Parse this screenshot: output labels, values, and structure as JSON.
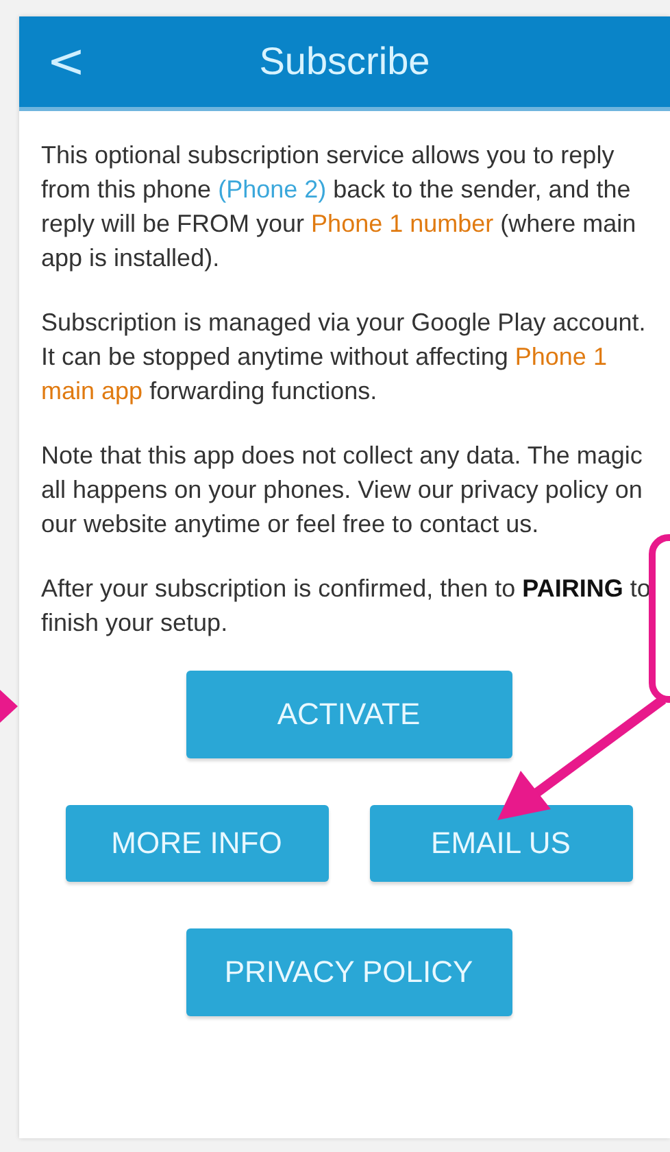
{
  "header": {
    "back": "<",
    "title": "Subscribe"
  },
  "paragraphs": [
    [
      {
        "kind": "plain",
        "text": "This optional subscription service allows you to reply from this phone "
      },
      {
        "kind": "link",
        "text": "(Phone 2)"
      },
      {
        "kind": "plain",
        "text": " back to the sender, and the reply will be FROM your "
      },
      {
        "kind": "accent",
        "text": "Phone 1 number"
      },
      {
        "kind": "plain",
        "text": " (where main app is installed)."
      }
    ],
    [
      {
        "kind": "plain",
        "text": "Subscription is managed via your Google Play account. It can be stopped anytime without affecting "
      },
      {
        "kind": "accent",
        "text": "Phone 1 main app"
      },
      {
        "kind": "plain",
        "text": " forwarding functions."
      }
    ],
    [
      {
        "kind": "plain",
        "text": "Note that this app does not collect any data. The magic all happens on your phones. View our privacy policy on our website anytime or feel free to contact us."
      }
    ],
    [
      {
        "kind": "plain",
        "text": "After your subscription is confirmed, then "
      },
      {
        "kind": "plain",
        "text": "to "
      },
      {
        "kind": "bold",
        "text": "PAIRING"
      },
      {
        "kind": "plain",
        "text": " to finish your setup."
      }
    ]
  ],
  "buttons": [
    [
      "ACTIVATE"
    ],
    [
      "MORE INFO",
      "EMAIL US"
    ],
    [
      "PRIVACY POLICY"
    ]
  ]
}
